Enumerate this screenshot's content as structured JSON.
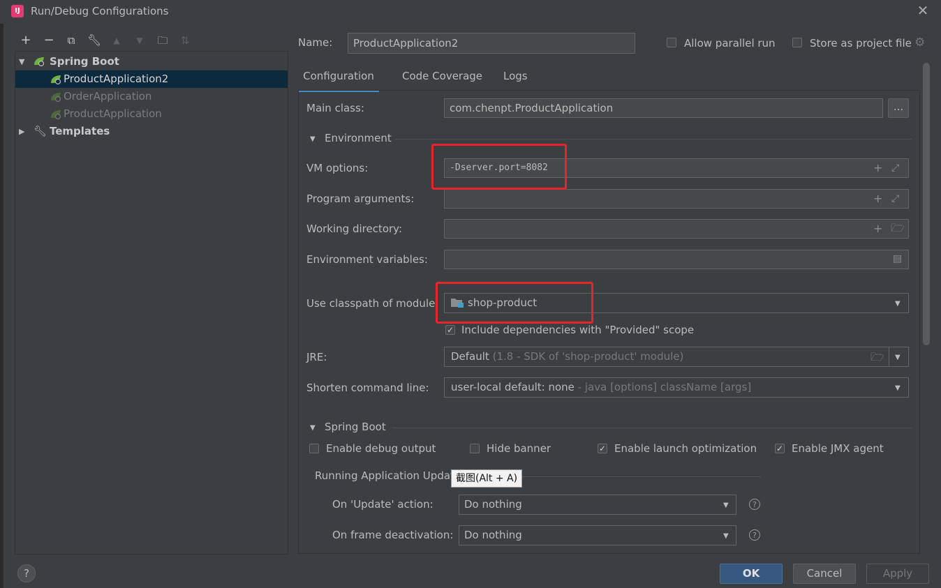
{
  "window": {
    "title": "Run/Debug Configurations",
    "app_icon": "IJ"
  },
  "toolbar": [
    "add-icon",
    "remove-icon",
    "copy-icon",
    "wrench-icon",
    "move-up-icon",
    "move-down-icon",
    "folder-add-icon",
    "sort-icon"
  ],
  "tree": {
    "group": "Spring Boot",
    "items": [
      "ProductApplication2",
      "OrderApplication",
      "ProductApplication"
    ],
    "templates": "Templates"
  },
  "header": {
    "name_label": "Name:",
    "name_value": "ProductApplication2",
    "allow_parallel": "Allow parallel run",
    "store_as_project": "Store as project file"
  },
  "tabs": [
    "Configuration",
    "Code Coverage",
    "Logs"
  ],
  "form": {
    "main_class_label": "Main class:",
    "main_class_value": "com.chenpt.ProductApplication",
    "browse_label": "...",
    "environment_section": "Environment",
    "vm_options_label": "VM options:",
    "vm_options_value": "-Dserver.port=8082",
    "program_args_label": "Program arguments:",
    "working_dir_label": "Working directory:",
    "env_vars_label": "Environment variables:",
    "classpath_label": "Use classpath of module:",
    "classpath_value": "shop-product",
    "include_deps_label": "Include dependencies with \"Provided\" scope",
    "jre_label": "JRE:",
    "jre_value": "Default",
    "jre_hint": "(1.8 - SDK of 'shop-product' module)",
    "shorten_label": "Shorten command line:",
    "shorten_value": "user-local default: none",
    "shorten_hint": "- java [options] className [args]"
  },
  "spring_boot": {
    "section": "Spring Boot",
    "debug_output": "Enable debug output",
    "hide_banner": "Hide banner",
    "launch_opt": "Enable launch optimization",
    "jmx_agent": "Enable JMX agent",
    "running_updates": "Running Application Updat",
    "tooltip": "截图(Alt + A)",
    "on_update_label": "On 'Update' action:",
    "on_update_value": "Do nothing",
    "on_frame_label": "On frame deactivation:",
    "on_frame_value": "Do nothing"
  },
  "buttons": {
    "help": "?",
    "ok": "OK",
    "cancel": "Cancel",
    "apply": "Apply"
  },
  "colors": {
    "background": "#3c3f41",
    "selection": "#0d293e",
    "ok_button": "#365880",
    "highlight": "#e5242b",
    "spring_green": "#6db33f"
  }
}
